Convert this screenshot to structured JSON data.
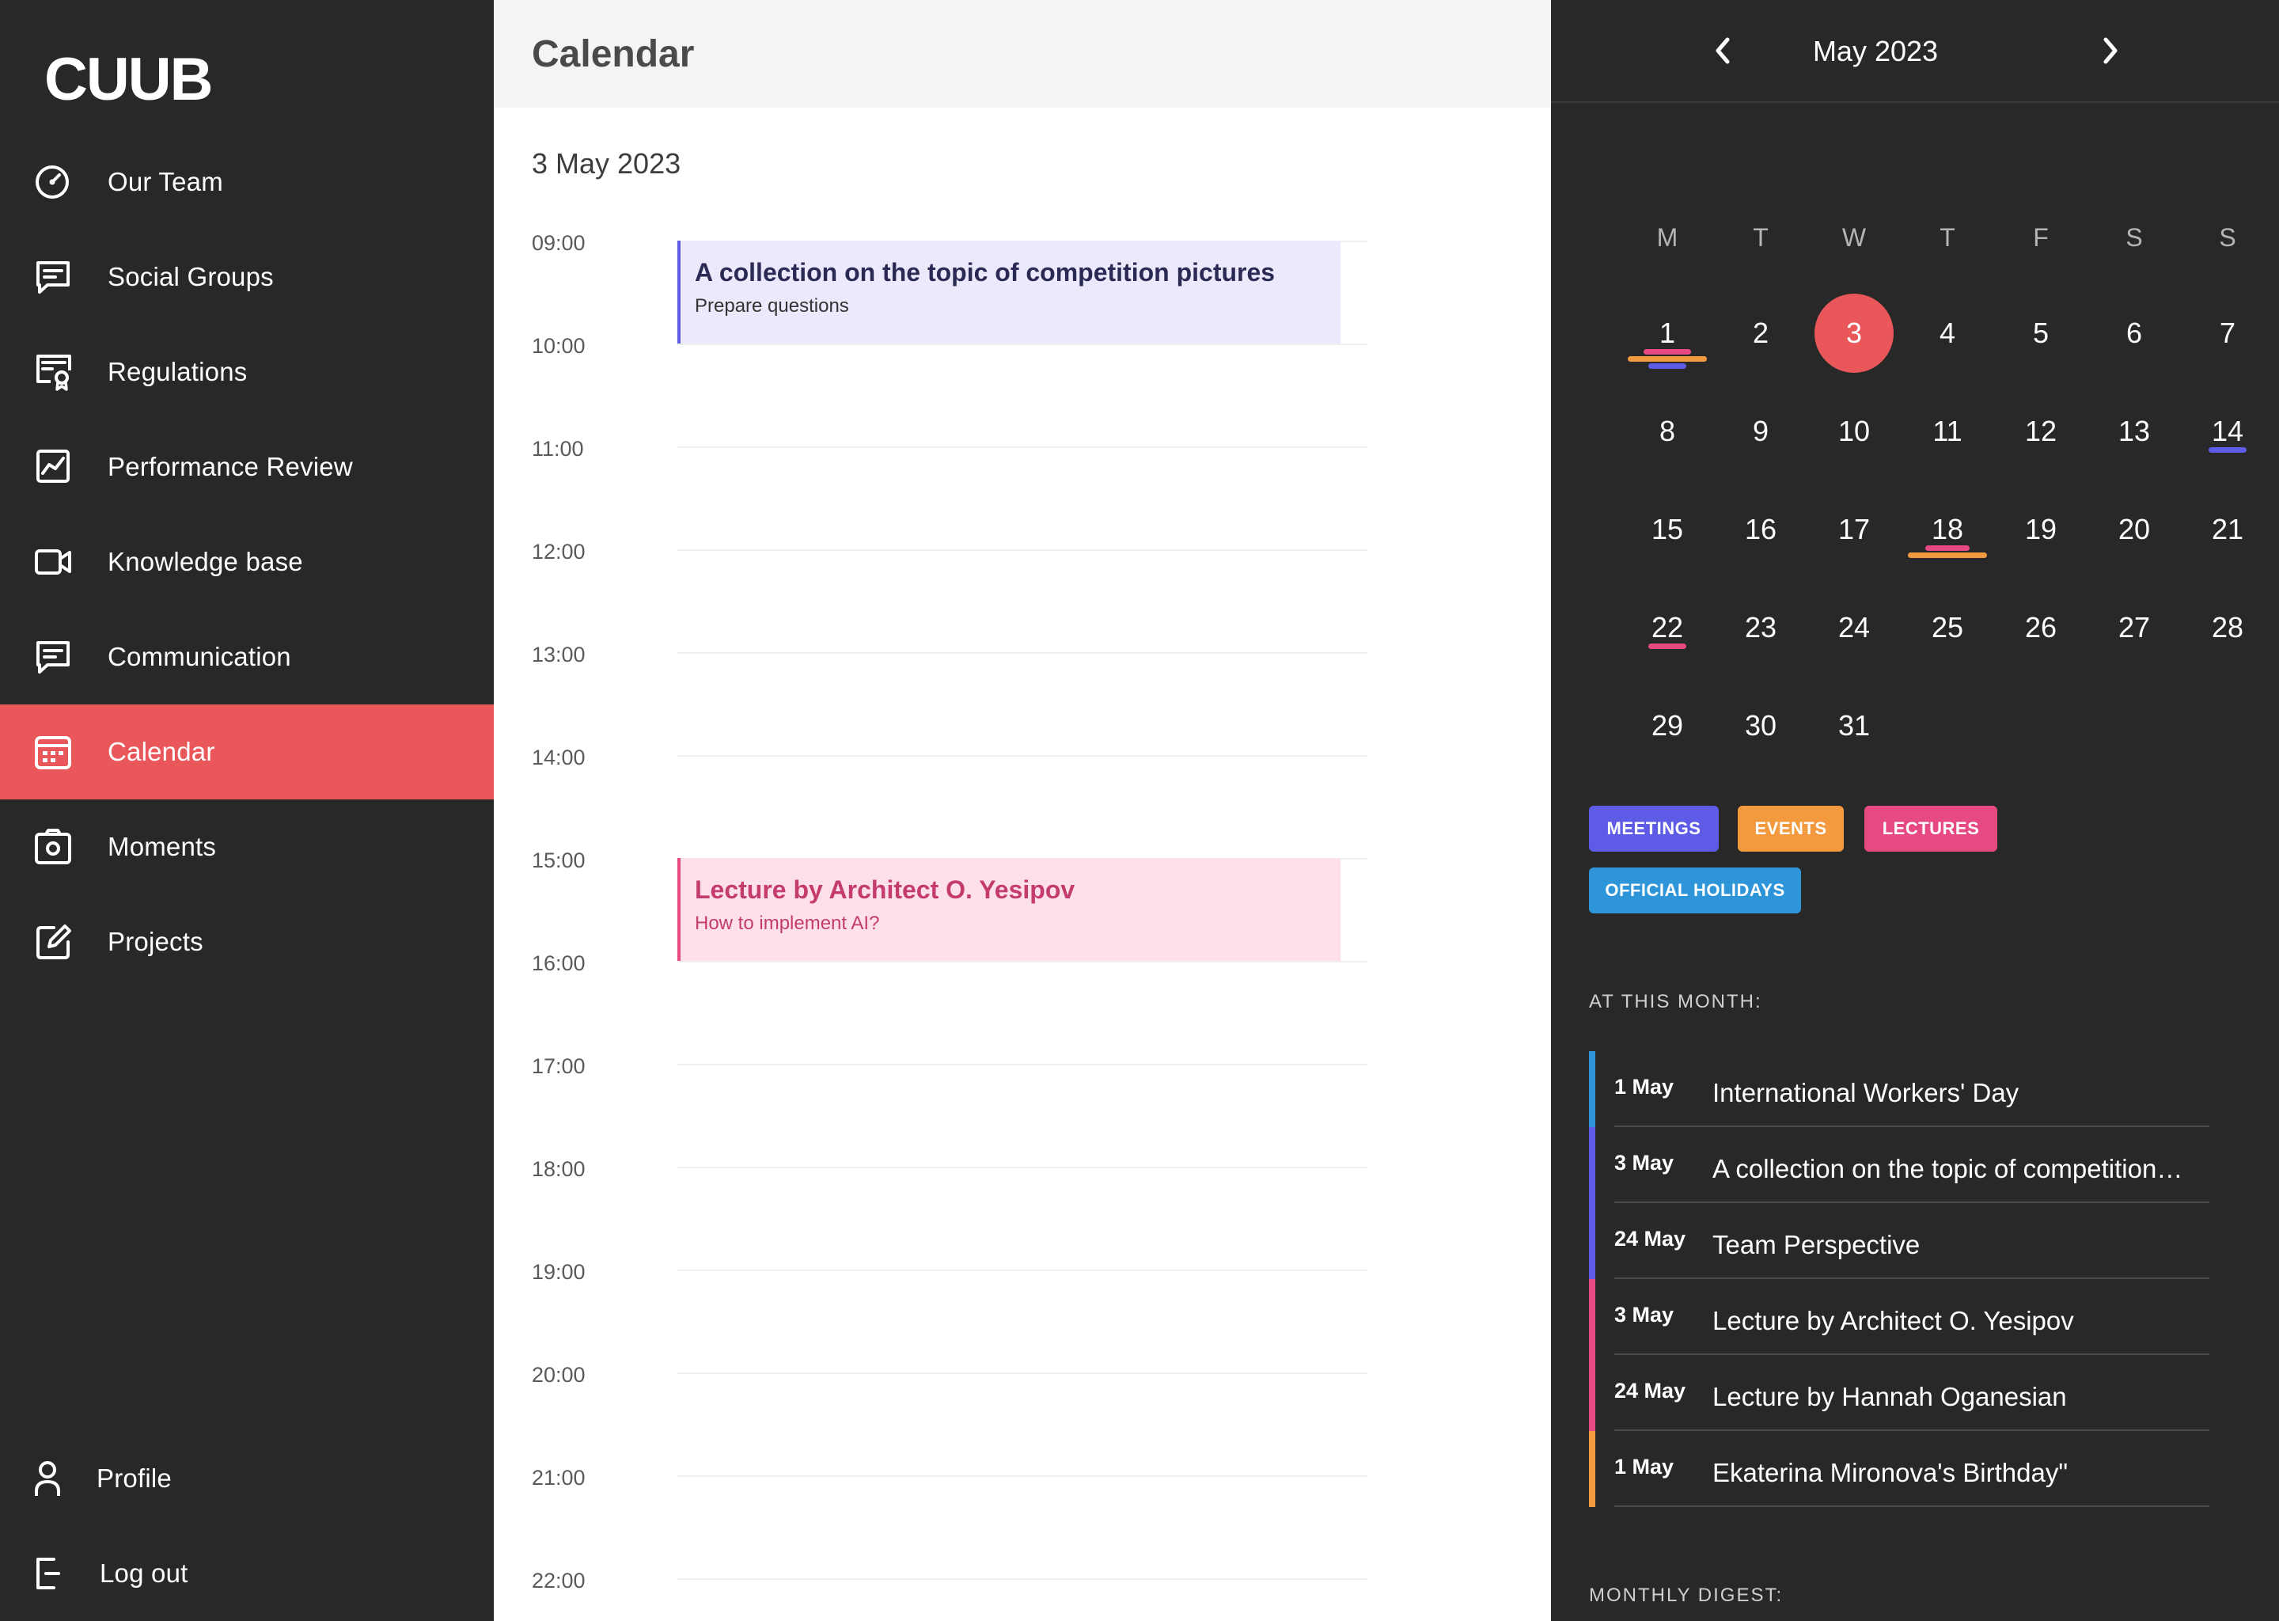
{
  "brand": {
    "logo_text": "CUUB"
  },
  "sidebar": {
    "items": [
      {
        "label": "Our Team",
        "icon": "gauge-icon"
      },
      {
        "label": "Social Groups",
        "icon": "chat-icon"
      },
      {
        "label": "Regulations",
        "icon": "certificate-icon"
      },
      {
        "label": "Performance Review",
        "icon": "chart-icon"
      },
      {
        "label": "Knowledge base",
        "icon": "video-icon"
      },
      {
        "label": "Communication",
        "icon": "message-icon"
      },
      {
        "label": "Calendar",
        "icon": "calendar-icon",
        "active": true
      },
      {
        "label": "Moments",
        "icon": "camera-icon"
      },
      {
        "label": "Projects",
        "icon": "edit-icon"
      }
    ],
    "bottom": [
      {
        "label": "Profile",
        "icon": "user-icon"
      },
      {
        "label": "Log out",
        "icon": "logout-icon"
      }
    ]
  },
  "main": {
    "title": "Calendar",
    "date_heading": "3 May 2023",
    "hours": [
      "09:00",
      "10:00",
      "11:00",
      "12:00",
      "13:00",
      "14:00",
      "15:00",
      "16:00",
      "17:00",
      "18:00",
      "19:00",
      "20:00",
      "21:00",
      "22:00"
    ],
    "events": [
      {
        "title": "A collection on the topic of competition pictures",
        "subtitle": "Prepare questions",
        "category": "meeting",
        "start": "09:00",
        "end": "10:00"
      },
      {
        "title": "Lecture by Architect O. Yesipov",
        "subtitle": "How to implement AI?",
        "category": "lecture",
        "start": "15:00",
        "end": "16:00"
      }
    ]
  },
  "mini_calendar": {
    "month_label": "May 2023",
    "weekdays": [
      "M",
      "T",
      "W",
      "T",
      "F",
      "S",
      "S"
    ],
    "days": [
      "1",
      "2",
      "3",
      "4",
      "5",
      "6",
      "7",
      "8",
      "9",
      "10",
      "11",
      "12",
      "13",
      "14",
      "15",
      "16",
      "17",
      "18",
      "19",
      "20",
      "21",
      "22",
      "23",
      "24",
      "25",
      "26",
      "27",
      "28",
      "29",
      "30",
      "31"
    ],
    "selected_day": "3",
    "day_markers": {
      "1": [
        "lecture",
        "event",
        "meeting"
      ],
      "14": [
        "meeting"
      ],
      "18": [
        "lecture",
        "event"
      ],
      "22": [
        "lecture"
      ]
    }
  },
  "categories": [
    {
      "key": "meeting",
      "label": "MEETINGS",
      "color": "#5e5ce6"
    },
    {
      "key": "event",
      "label": "EVENTS",
      "color": "#f39a3f"
    },
    {
      "key": "lecture",
      "label": "LECTURES",
      "color": "#e74a83"
    },
    {
      "key": "holiday",
      "label": "OFFICIAL HOLIDAYS",
      "color": "#2e95d8"
    }
  ],
  "month_section": {
    "heading": "AT THIS MONTH:",
    "items": [
      {
        "date": "1 May",
        "title": "International Workers' Day",
        "category": "holiday"
      },
      {
        "date": "3 May",
        "title": "A collection on the topic of competition…",
        "category": "meeting"
      },
      {
        "date": "24 May",
        "title": "Team Perspective",
        "category": "meeting"
      },
      {
        "date": "3 May",
        "title": "Lecture by Architect O. Yesipov",
        "category": "lecture"
      },
      {
        "date": "24 May",
        "title": "Lecture by Hannah Oganesian",
        "category": "lecture"
      },
      {
        "date": "1 May",
        "title": "Ekaterina Mironova's Birthday\"",
        "category": "event"
      }
    ]
  },
  "digest": {
    "heading": "MONTHLY DIGEST:"
  },
  "colors": {
    "accent": "#e9575a",
    "sidebar_bg": "#282828",
    "panel_bg": "#282828"
  }
}
